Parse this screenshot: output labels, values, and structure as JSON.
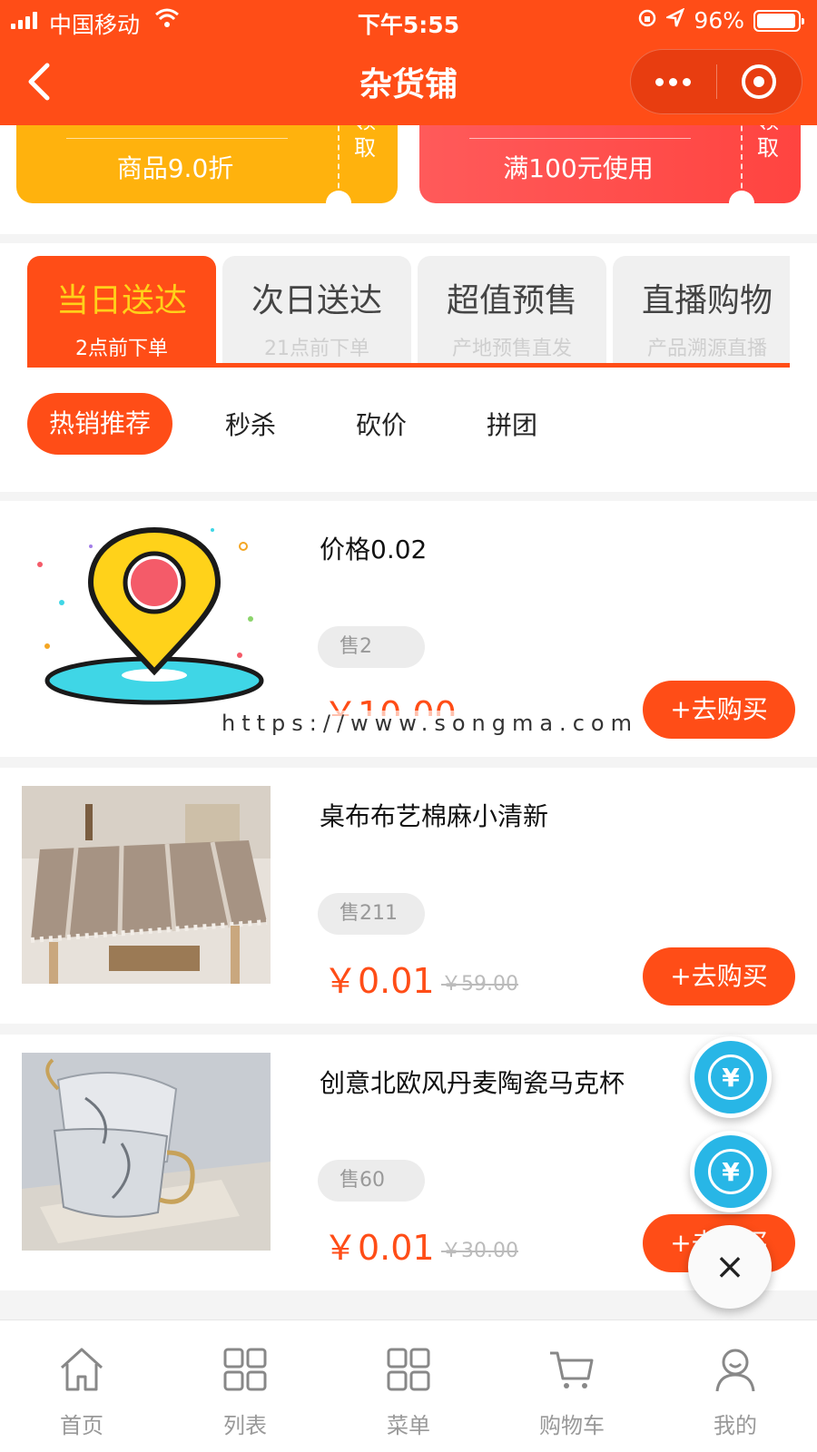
{
  "status_bar": {
    "carrier": "中国移动",
    "time": "下午5:55",
    "battery": "96%",
    "battery_level": 0.96
  },
  "nav": {
    "title": "杂货铺"
  },
  "coupons": [
    {
      "desc": "商品9.0折",
      "action": "领取"
    },
    {
      "desc": "满100元使用",
      "action": "领取"
    }
  ],
  "delivery_tabs": [
    {
      "title": "当日送达",
      "subtitle": "2点前下单"
    },
    {
      "title": "次日送达",
      "subtitle": "21点前下单"
    },
    {
      "title": "超值预售",
      "subtitle": "产地预售直发"
    },
    {
      "title": "直播购物",
      "subtitle": "产品溯源直播"
    }
  ],
  "sub_tabs": [
    "热销推荐",
    "秒杀",
    "砍价",
    "拼团"
  ],
  "products": [
    {
      "name": "价格0.02",
      "sold": "售2",
      "price": "￥10.00",
      "old_price": "",
      "buy": "+去购买"
    },
    {
      "name": "桌布布艺棉麻小清新",
      "sold": "售211",
      "price": "￥0.01",
      "old_price": "￥59.00",
      "buy": "+去购买"
    },
    {
      "name": "创意北欧风丹麦陶瓷马克杯",
      "sold": "售60",
      "price": "￥0.01",
      "old_price": "￥30.00",
      "buy": "+去购买"
    }
  ],
  "watermark": "https://www.songma.com",
  "fab": {
    "yen": "¥",
    "close": "×"
  },
  "tabbar": [
    {
      "label": "首页",
      "icon": "home-icon"
    },
    {
      "label": "列表",
      "icon": "grid-icon"
    },
    {
      "label": "菜单",
      "icon": "grid-icon"
    },
    {
      "label": "购物车",
      "icon": "cart-icon"
    },
    {
      "label": "我的",
      "icon": "user-icon"
    }
  ],
  "colors": {
    "brand": "#ff4d17",
    "coupon_yellow": "#ffb20d",
    "coupon_red": "#ff4a45",
    "fab_blue": "#28b6e6"
  }
}
